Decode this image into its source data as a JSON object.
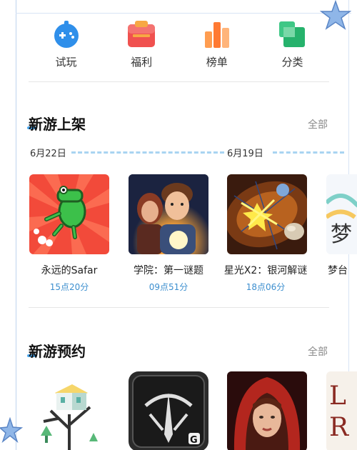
{
  "nav": [
    {
      "label": "试玩",
      "icon": "gamepad-icon"
    },
    {
      "label": "福利",
      "icon": "gift-icon"
    },
    {
      "label": "榜单",
      "icon": "ranking-icon"
    },
    {
      "label": "分类",
      "icon": "category-icon"
    }
  ],
  "new_games": {
    "title": "新游上架",
    "all_label": "全部",
    "dates": [
      "6月22日",
      "6月19日"
    ],
    "items": [
      {
        "name": "永远的Safar",
        "time": "15点20分",
        "image": "green-crocodile-game-icon"
      },
      {
        "name": "学院：第一谜题",
        "time": "09点51分",
        "image": "academy-characters-game-icon"
      },
      {
        "name": "星光X2：银河解谜",
        "time": "18点06分",
        "image": "starlight-puzzle-game-icon"
      },
      {
        "name": "梦台",
        "time": "",
        "image": "dream-game-icon"
      }
    ]
  },
  "preorder": {
    "title": "新游预约",
    "all_label": "全部",
    "items": [
      {
        "image": "treehouse-game-icon"
      },
      {
        "image": "dark-emblem-game-icon"
      },
      {
        "image": "red-hood-game-icon"
      },
      {
        "image": "letters-game-icon"
      }
    ]
  },
  "colors": {
    "accent": "#3d8fcf",
    "title_mark": "#4aa7ee",
    "timeline_dash": "#a9d4f1"
  }
}
